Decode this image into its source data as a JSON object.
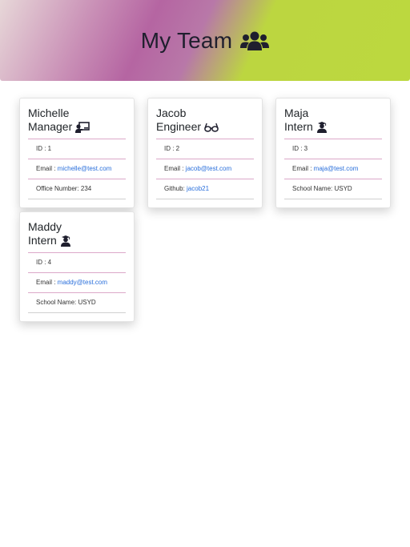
{
  "header": {
    "title": "My Team",
    "icon": "users-icon"
  },
  "cards": [
    {
      "name": "Michelle",
      "role": "Manager",
      "role_icon": "chalkboard-teacher-icon",
      "id_label": "ID : 1",
      "email_label": "Email : ",
      "email": "michelle@test.com",
      "extra_label": "Office Number: 234",
      "extra_link": ""
    },
    {
      "name": "Jacob",
      "role": "Engineer",
      "role_icon": "glasses-icon",
      "id_label": "ID : 2",
      "email_label": "Email : ",
      "email": "jacob@test.com",
      "extra_label": "Github: ",
      "extra_link": "jacob21"
    },
    {
      "name": "Maja",
      "role": "Intern",
      "role_icon": "user-graduate-icon",
      "id_label": "ID : 3",
      "email_label": "Email : ",
      "email": "maja@test.com",
      "extra_label": "School Name: USYD",
      "extra_link": ""
    },
    {
      "name": "Maddy",
      "role": "Intern",
      "role_icon": "user-graduate-icon",
      "id_label": "ID : 4",
      "email_label": "Email : ",
      "email": "maddy@test.com",
      "extra_label": "School Name: USYD",
      "extra_link": ""
    }
  ]
}
